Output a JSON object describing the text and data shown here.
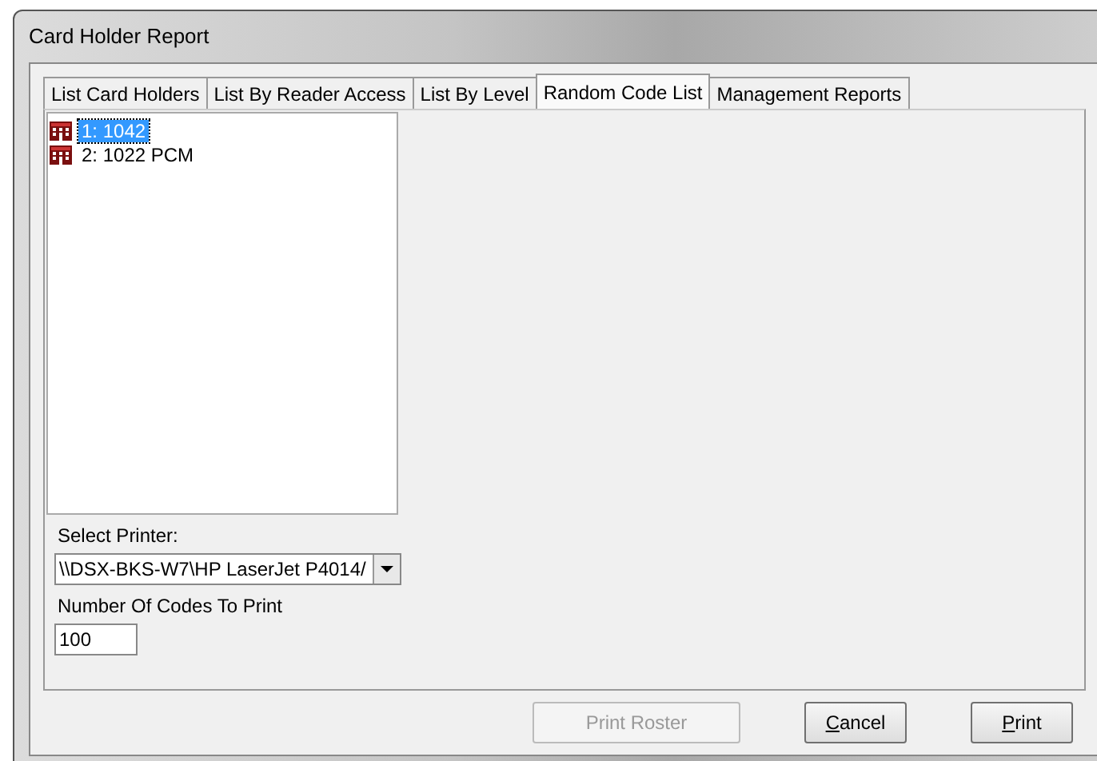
{
  "window": {
    "title": "Card Holder Report"
  },
  "tabs": [
    {
      "label": "List Card Holders",
      "selected": false
    },
    {
      "label": "List By Reader Access",
      "selected": false
    },
    {
      "label": "List By Level",
      "selected": false
    },
    {
      "label": "Random Code List",
      "selected": true
    },
    {
      "label": "Management Reports",
      "selected": false
    }
  ],
  "list": [
    {
      "label": "1:  1042",
      "selected": true
    },
    {
      "label": "2:  1022 PCM",
      "selected": false
    }
  ],
  "printer": {
    "label": "Select Printer:",
    "value": "\\\\DSX-BKS-W7\\HP LaserJet P4014/"
  },
  "codes": {
    "label": "Number Of Codes To Print",
    "value": "100"
  },
  "buttons": [
    {
      "label": "Print Roster",
      "disabled": true,
      "mnemonic": false
    },
    {
      "label": "Cancel",
      "disabled": false,
      "mnemonic": true
    },
    {
      "label": "Print",
      "disabled": false,
      "mnemonic": true
    }
  ]
}
